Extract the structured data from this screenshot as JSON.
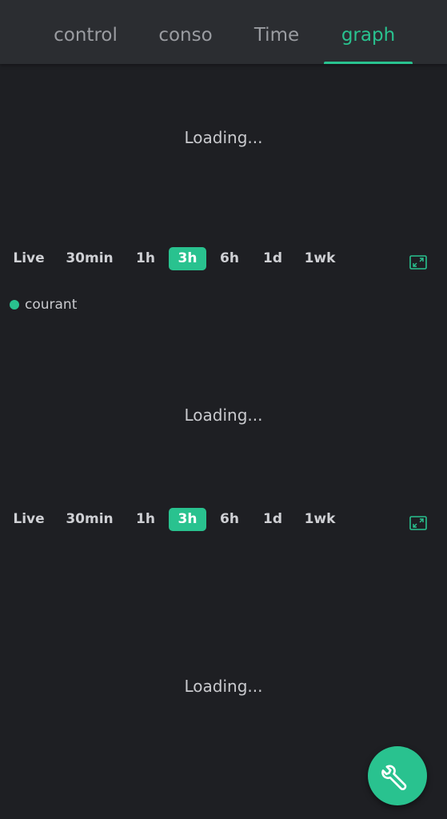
{
  "tabs": [
    {
      "label": "control",
      "active": false
    },
    {
      "label": "conso",
      "active": false
    },
    {
      "label": "Time",
      "active": false
    },
    {
      "label": "graph",
      "active": true
    }
  ],
  "panels": [
    {
      "loading_text": "Loading...",
      "ranges": [
        "Live",
        "30min",
        "1h",
        "3h",
        "6h",
        "1d",
        "1wk"
      ],
      "selected_range": "3h",
      "legend": [
        {
          "label": "courant",
          "color": "#29c28f"
        }
      ]
    },
    {
      "loading_text": "Loading...",
      "ranges": [
        "Live",
        "30min",
        "1h",
        "3h",
        "6h",
        "1d",
        "1wk"
      ],
      "selected_range": "3h"
    },
    {
      "loading_text": "Loading..."
    }
  ],
  "fab": {
    "icon": "wrench-icon"
  },
  "colors": {
    "accent": "#29c28f",
    "background": "#1e1f23",
    "tabbar": "#2b2d31"
  }
}
